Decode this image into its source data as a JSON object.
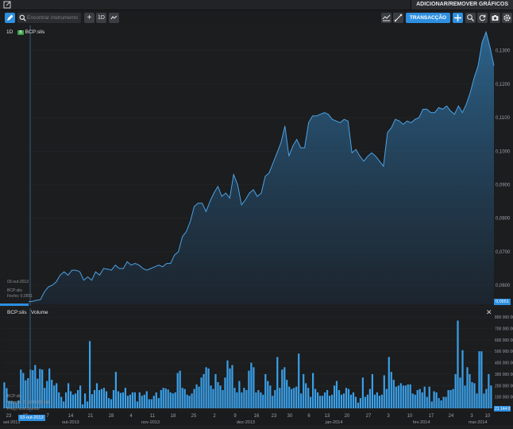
{
  "topbar": {
    "add_remove_label": "ADICIONAR/REMOVER GRÁFICOS"
  },
  "toolbar": {
    "search_placeholder": "Encontrar instrumento",
    "plus_label": "+",
    "interval_label": "1D",
    "trade_label": "TRANSACÇÃO"
  },
  "price_panel": {
    "interval": "1D",
    "instrument": "BCP:slis",
    "hover_date": "03-out-2013",
    "hover_name": "BCP:slis",
    "hover_close": "Fecho: 0,0551",
    "last_price": "0,0551",
    "y_ticks": [
      "0,1300",
      "0,1200",
      "0,1100",
      "0,1000",
      "0,0900",
      "0,0800",
      "0,0700",
      "0,0600"
    ]
  },
  "volume_panel": {
    "instrument": "BCP:slis",
    "indicator": "Volume",
    "close_label": "✕",
    "hover_name": "BCP:slis",
    "hover_volume": "Volume: 21 224 066 666",
    "hover_note": "Preço instrumento",
    "last_volume": "21 144 0",
    "y_ticks": [
      "800 000 000",
      "700 000 000",
      "600 000 000",
      "500 000 000",
      "400 000 000",
      "300 000 000",
      "200 000 000",
      "100 000 000"
    ]
  },
  "x_axis": {
    "hover_date": "03-out-2013",
    "day_ticks": [
      "23",
      "30",
      "7",
      "14",
      "21",
      "28",
      "4",
      "11",
      "18",
      "25",
      "2",
      "9",
      "16",
      "23",
      "30",
      "6",
      "13",
      "20",
      "27",
      "3",
      "10",
      "17",
      "24",
      "3",
      "10"
    ],
    "month_ticks": [
      "set-2013",
      "out-2013",
      "nov-2013",
      "dez-2013",
      "jan-2014",
      "fev-2014",
      "mar-2014"
    ]
  },
  "colors": {
    "accent": "#2d8fe0",
    "line": "#4aa3e8",
    "volume_bar": "#3aa0e8",
    "background": "#1c1d1f"
  },
  "chart_data": [
    {
      "type": "area",
      "series": [
        {
          "name": "BCP:slis",
          "values": [
            0.0551,
            0.0552,
            0.0555,
            0.0557,
            0.058,
            0.0595,
            0.06,
            0.061,
            0.063,
            0.064,
            0.063,
            0.0645,
            0.0645,
            0.064,
            0.0615,
            0.0625,
            0.0615,
            0.064,
            0.063,
            0.065,
            0.0648,
            0.0645,
            0.066,
            0.065,
            0.065,
            0.067,
            0.066,
            0.0665,
            0.066,
            0.065,
            0.0645,
            0.065,
            0.0655,
            0.066,
            0.0655,
            0.0665,
            0.0665,
            0.069,
            0.07,
            0.0745,
            0.076,
            0.079,
            0.0835,
            0.0845,
            0.0845,
            0.082,
            0.085,
            0.0875,
            0.0895,
            0.0865,
            0.0875,
            0.086,
            0.093,
            0.09,
            0.084,
            0.0855,
            0.0875,
            0.0885,
            0.0865,
            0.0875,
            0.0925,
            0.0935,
            0.0965,
            0.0995,
            0.1025,
            0.1075,
            0.0985,
            0.1015,
            0.1035,
            0.101,
            0.101,
            0.1085,
            0.1105,
            0.1105,
            0.111,
            0.1115,
            0.111,
            0.1095,
            0.109,
            0.1085,
            0.1095,
            0.109,
            0.0995,
            0.1005,
            0.0985,
            0.097,
            0.0985,
            0.0995,
            0.0985,
            0.097,
            0.0955,
            0.1055,
            0.107,
            0.1095,
            0.109,
            0.108,
            0.109,
            0.1085,
            0.1095,
            0.11,
            0.1125,
            0.1125,
            0.1115,
            0.1115,
            0.113,
            0.1125,
            0.1135,
            0.112,
            0.111,
            0.1135,
            0.1115,
            0.114,
            0.1175,
            0.122,
            0.1255,
            0.1325,
            0.1355,
            0.131,
            0.1255
          ]
        }
      ],
      "ylim": [
        0.0548,
        0.1375
      ]
    },
    {
      "type": "bar",
      "series": [
        {
          "name": "Volume",
          "values": [
            228,
            178,
            65,
            65,
            60,
            50,
            70,
            340,
            310,
            245,
            265,
            340,
            335,
            380,
            260,
            345,
            340,
            180,
            240,
            350,
            250,
            200,
            220,
            140,
            100,
            60,
            140,
            220,
            150,
            120,
            130,
            160,
            200,
            35,
            130,
            60,
            590,
            125,
            160,
            220,
            160,
            170,
            180,
            150,
            90,
            80,
            160,
            320,
            150,
            135,
            140,
            180,
            110,
            120,
            140,
            140,
            60,
            140,
            110,
            120,
            150,
            80,
            80,
            110,
            140,
            90,
            160,
            180,
            175,
            165,
            140,
            130,
            140,
            310,
            330,
            180,
            170,
            120,
            110,
            130,
            170,
            210,
            190,
            270,
            300,
            360,
            350,
            200,
            170,
            300,
            230,
            200,
            160,
            270,
            420,
            350,
            380,
            180,
            140,
            240,
            140,
            180,
            160,
            330,
            400,
            360,
            140,
            160,
            140,
            120,
            300,
            240,
            200,
            110,
            160,
            450,
            180,
            340,
            360,
            250,
            190,
            170,
            180,
            190,
            480,
            130,
            300,
            220,
            180,
            100,
            310,
            170,
            140,
            110,
            110,
            140,
            160,
            110,
            120,
            200,
            240,
            160,
            120,
            130,
            180,
            170,
            120,
            140,
            100,
            50,
            90,
            270,
            100,
            120,
            170,
            300,
            120,
            140,
            110,
            120,
            290,
            170,
            450,
            320,
            250,
            190,
            200,
            220,
            200,
            200,
            210,
            210,
            130,
            120,
            160,
            170,
            140,
            190,
            100,
            190,
            60,
            150,
            140,
            90,
            70,
            100,
            100,
            160,
            160,
            170,
            300,
            770,
            270,
            510,
            200,
            360,
            300,
            230,
            220,
            130,
            500,
            500,
            130,
            170,
            300,
            200
          ]
        }
      ],
      "ylim": [
        0,
        850
      ]
    }
  ]
}
